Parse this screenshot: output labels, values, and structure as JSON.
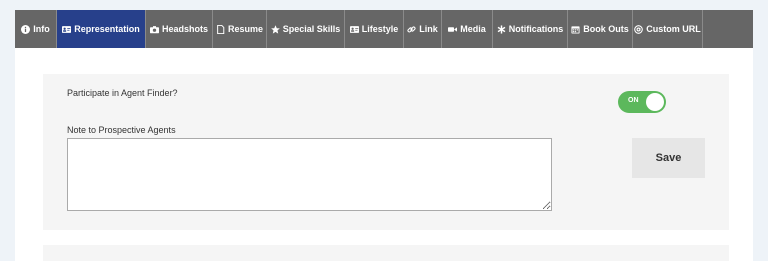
{
  "tabs": [
    {
      "label": "Info",
      "icon": "info-icon",
      "active": false
    },
    {
      "label": "Representation",
      "icon": "id-card-icon",
      "active": true
    },
    {
      "label": "Headshots",
      "icon": "camera-icon",
      "active": false
    },
    {
      "label": "Resume",
      "icon": "file-icon",
      "active": false
    },
    {
      "label": "Special Skills",
      "icon": "star-icon",
      "active": false
    },
    {
      "label": "Lifestyle",
      "icon": "id-card-icon",
      "active": false
    },
    {
      "label": "Link",
      "icon": "link-icon",
      "active": false
    },
    {
      "label": "Media",
      "icon": "video-icon",
      "active": false
    },
    {
      "label": "Notifications",
      "icon": "asterisk-icon",
      "active": false
    },
    {
      "label": "Book Outs",
      "icon": "calendar-icon",
      "active": false
    },
    {
      "label": "Custom URL",
      "icon": "at-icon",
      "active": false
    }
  ],
  "form": {
    "agent_finder_label": "Participate in Agent Finder?",
    "toggle_state": "ON",
    "note_label": "Note to Prospective Agents",
    "note_value": "",
    "save_label": "Save"
  },
  "colors": {
    "tab_bar": "#666666",
    "tab_active": "#27408b",
    "toggle_on": "#5cb85c",
    "panel": "#f5f5f5"
  }
}
